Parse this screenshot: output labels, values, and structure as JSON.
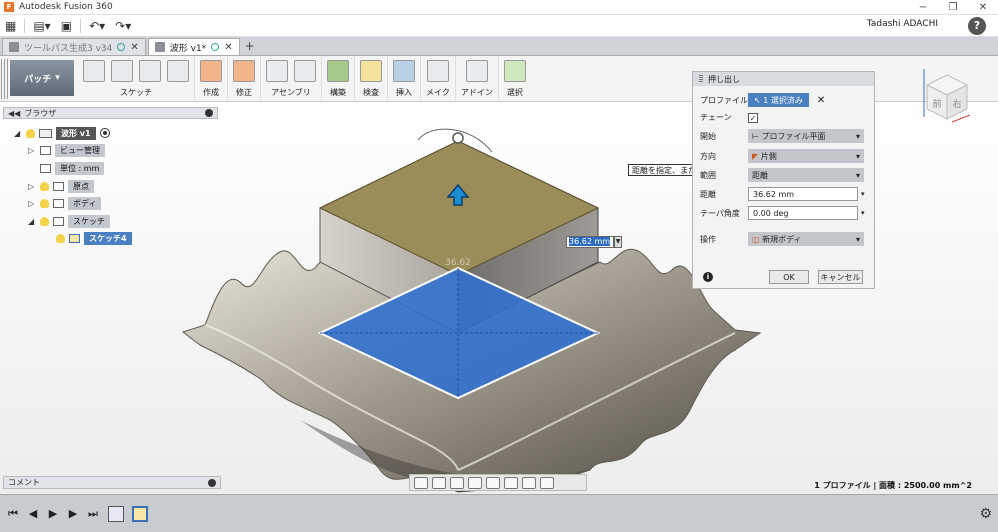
{
  "title": "Autodesk Fusion 360",
  "user": "Tadashi ADACHI",
  "tabs": [
    {
      "label": "ツールパス生成3 v34"
    },
    {
      "label": "波形 v1*"
    }
  ],
  "workspace": "パッチ",
  "ribbon_groups": [
    "スケッチ",
    "作成",
    "修正",
    "アセンブリ",
    "構築",
    "検査",
    "挿入",
    "メイク",
    "アドイン",
    "選択"
  ],
  "browser": {
    "title": "ブラウザ",
    "root": "波形 v1",
    "items": [
      "ビュー管理",
      "単位 : mm",
      "原点",
      "ボディ",
      "スケッチ",
      "スケッチ4"
    ]
  },
  "viewcube": {
    "front": "前",
    "right": "右"
  },
  "dialog": {
    "title": "押し出し",
    "profile_label": "プロファイル",
    "profile_value": "1 選択済み",
    "chain_label": "チェーン",
    "start_label": "開始",
    "start_value": "プロファイル平面",
    "direction_label": "方向",
    "direction_value": "片側",
    "extent_label": "範囲",
    "extent_value": "距離",
    "distance_label": "距離",
    "distance_value": "36.62 mm",
    "taper_label": "テーパ角度",
    "taper_value": "0.00 deg",
    "operation_label": "操作",
    "operation_value": "新規ボディ",
    "ok": "OK",
    "cancel": "キャンセル"
  },
  "tooltip": "距離を指定、または[Ctrl]/[Cmd]を押しながら選択内容を修正",
  "dimension_input": "36.62 mm",
  "ghost_label": "36.62",
  "comments": "コメント",
  "status": "1 プロファイル | 面積 : 2500.00 mm^2",
  "colors": {
    "selection": "#2f6fd0",
    "body_top": "#9b8d5a",
    "accent": "#1e7fc0"
  }
}
